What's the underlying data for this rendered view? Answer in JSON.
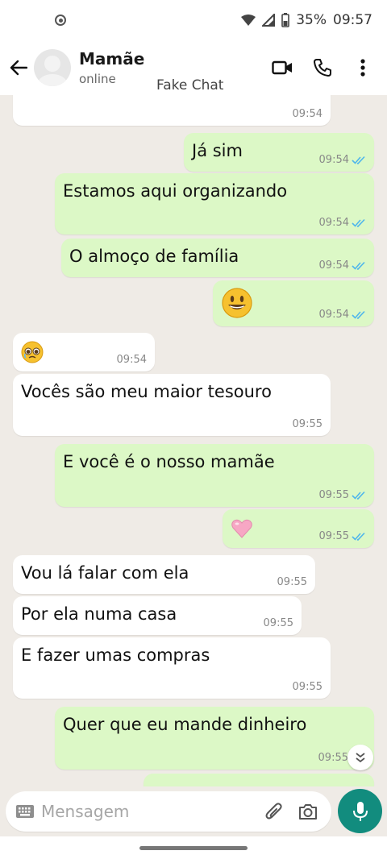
{
  "status_bar": {
    "battery": "35%",
    "time": "09:57",
    "icons": [
      "record-icon",
      "wifi-icon",
      "signal-icon",
      "battery-icon"
    ]
  },
  "header": {
    "contact_name": "Mamãe",
    "contact_status": "online",
    "caption": "Fake Chat",
    "icons": [
      "back-arrow-icon",
      "video-call-icon",
      "phone-icon",
      "more-icon"
    ]
  },
  "messages": [
    {
      "dir": "in",
      "text": "",
      "time": "09:54"
    },
    {
      "dir": "out",
      "text": "Já sim",
      "time": "09:54",
      "read": true
    },
    {
      "dir": "out",
      "text": "Estamos aqui organizando",
      "time": "09:54",
      "read": true
    },
    {
      "dir": "out",
      "text": "O almoço de família",
      "time": "09:54",
      "read": true
    },
    {
      "dir": "out",
      "text": "",
      "emoji": "smiling-face-emoji",
      "time": "09:54",
      "read": true
    },
    {
      "dir": "in",
      "text": "",
      "emoji": "pleading-face-emoji",
      "time": "09:54"
    },
    {
      "dir": "in",
      "text": "Vocês são meu maior tesouro",
      "time": "09:55"
    },
    {
      "dir": "out",
      "text": "E você é o nosso mamãe",
      "time": "09:55",
      "read": true
    },
    {
      "dir": "out",
      "text": "",
      "emoji": "pink-heart-emoji",
      "time": "09:55",
      "read": true
    },
    {
      "dir": "in",
      "text": "Vou lá falar com ela",
      "time": "09:55"
    },
    {
      "dir": "in",
      "text": "Por ela numa casa",
      "time": "09:55"
    },
    {
      "dir": "in",
      "text": "E fazer umas compras",
      "time": "09:55"
    },
    {
      "dir": "out",
      "text": "Quer que eu mande dinheiro",
      "time": "09:55",
      "read": true
    }
  ],
  "composer": {
    "placeholder": "Mensagem",
    "icons": [
      "keyboard-icon",
      "attach-icon",
      "camera-icon",
      "mic-icon"
    ]
  },
  "colors": {
    "outgoing_bubble": "#dcf8c6",
    "incoming_bubble": "#ffffff",
    "chat_background": "#efebe6",
    "accent": "#128c7e",
    "read_ticks": "#4fb6ec"
  }
}
